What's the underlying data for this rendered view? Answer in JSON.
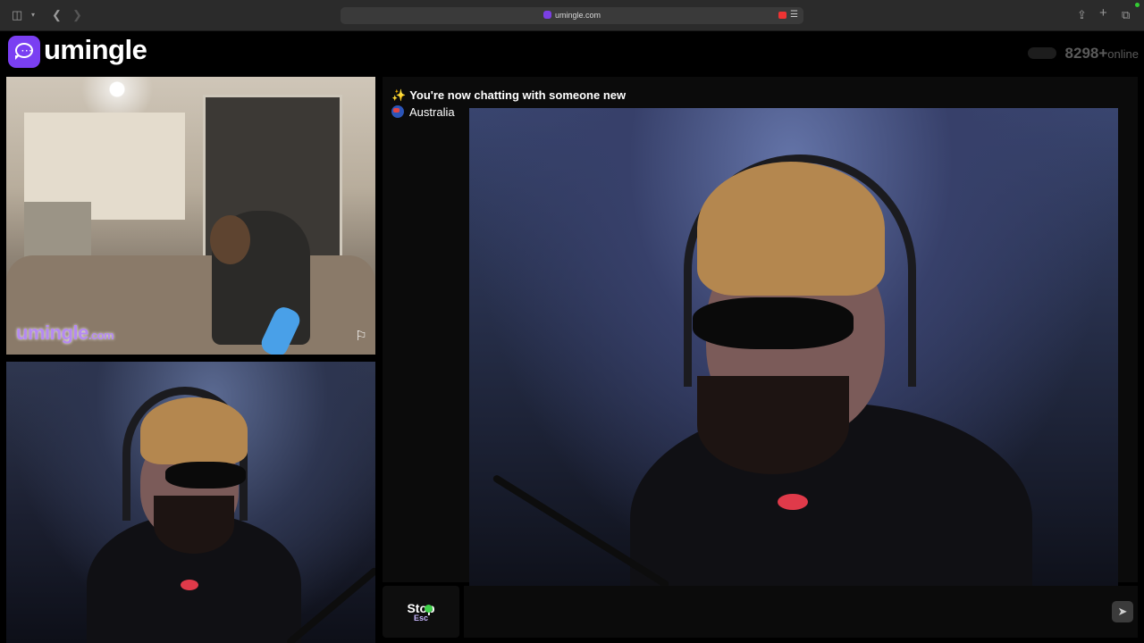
{
  "browser": {
    "url": "umingle.com",
    "icons": {
      "sidebar": "sidebar-icon",
      "back": "chevron-left-icon",
      "forward": "chevron-right-icon",
      "share": "share-icon",
      "new_tab": "plus-icon",
      "tabs": "tabs-icon"
    }
  },
  "header": {
    "logo_text": "umingle",
    "online_count": "8298+",
    "online_label": "online",
    "brand_color": "#7a3ff2"
  },
  "stranger_video": {
    "watermark_brand": "umingle",
    "watermark_suffix": ".com"
  },
  "chat": {
    "status": "You're now chatting with someone new",
    "country": "Australia"
  },
  "controls": {
    "stop_label": "Stop",
    "stop_key": "Esc",
    "message_placeholder": "",
    "send_icon": "send-icon"
  }
}
